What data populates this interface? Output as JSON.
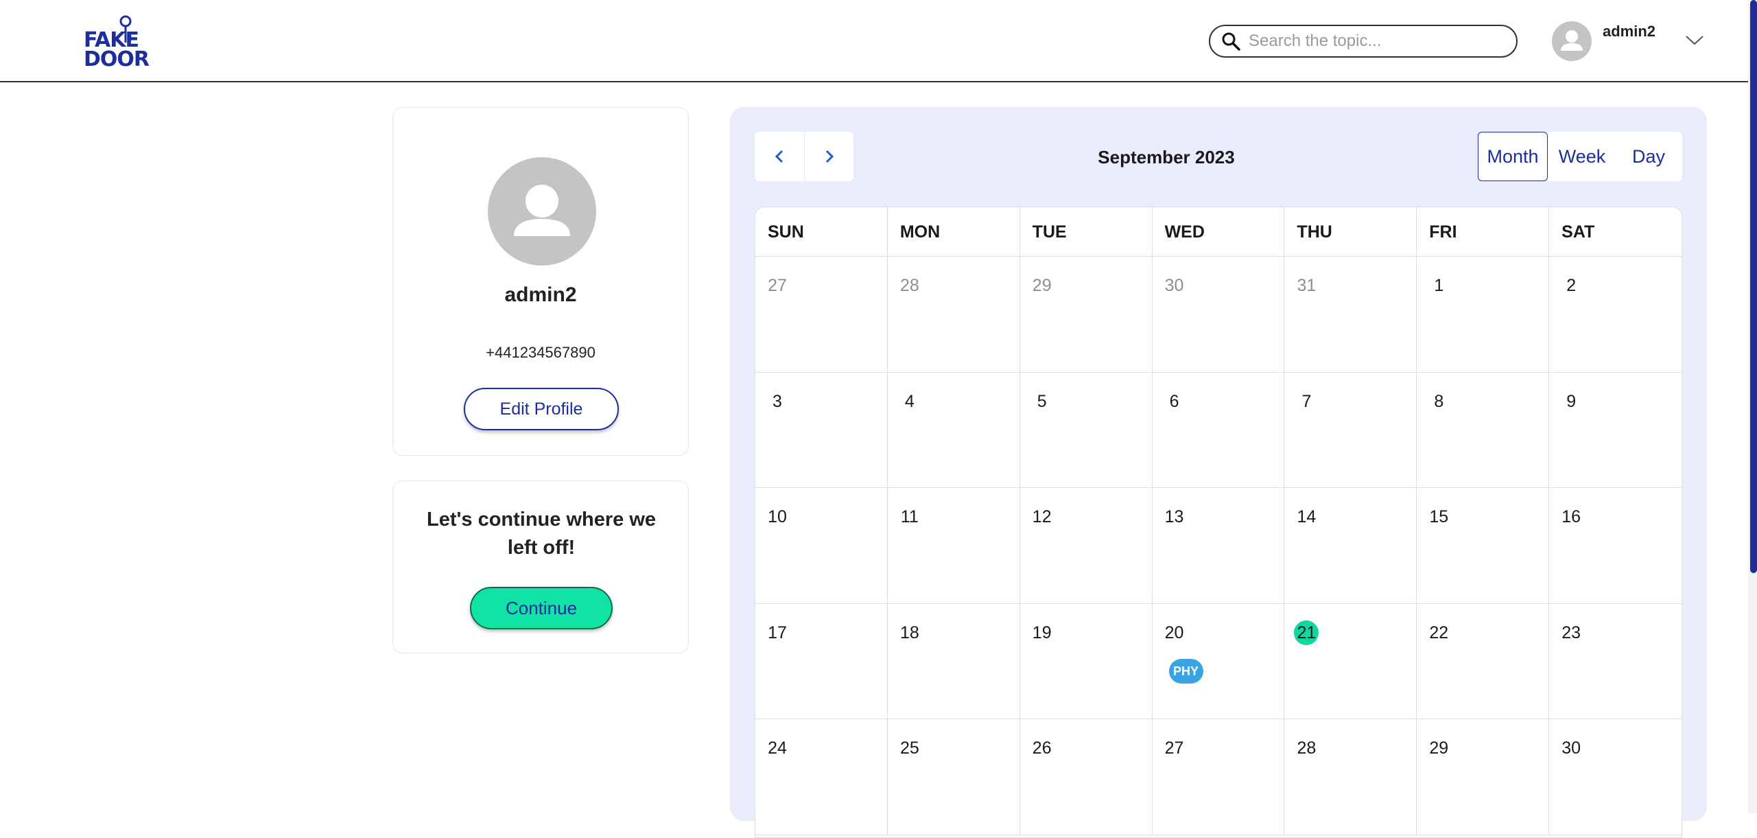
{
  "header": {
    "logo": {
      "line1": "FAKE",
      "line2": "DOOR"
    },
    "search": {
      "placeholder": "Search the topic..."
    },
    "username": "admin2"
  },
  "profile": {
    "name": "admin2",
    "phone": "+441234567890",
    "edit_label": "Edit Profile"
  },
  "continue_card": {
    "message": "Let's continue where we left off!",
    "button_label": "Continue"
  },
  "calendar": {
    "title": "September 2023",
    "views": [
      "Month",
      "Week",
      "Day"
    ],
    "active_view": "Month",
    "weekdays": [
      "SUN",
      "MON",
      "TUE",
      "WED",
      "THU",
      "FRI",
      "SAT"
    ],
    "days": [
      {
        "label": "27",
        "other": true
      },
      {
        "label": "28",
        "other": true
      },
      {
        "label": "29",
        "other": true
      },
      {
        "label": "30",
        "other": true
      },
      {
        "label": "31",
        "other": true
      },
      {
        "label": "1"
      },
      {
        "label": "2"
      },
      {
        "label": "3"
      },
      {
        "label": "4"
      },
      {
        "label": "5"
      },
      {
        "label": "6"
      },
      {
        "label": "7"
      },
      {
        "label": "8"
      },
      {
        "label": "9"
      },
      {
        "label": "10"
      },
      {
        "label": "11"
      },
      {
        "label": "12"
      },
      {
        "label": "13"
      },
      {
        "label": "14"
      },
      {
        "label": "15"
      },
      {
        "label": "16"
      },
      {
        "label": "17"
      },
      {
        "label": "18"
      },
      {
        "label": "19"
      },
      {
        "label": "20",
        "event": "PHY"
      },
      {
        "label": "21",
        "today": true
      },
      {
        "label": "22"
      },
      {
        "label": "23"
      },
      {
        "label": "24"
      },
      {
        "label": "25"
      },
      {
        "label": "26"
      },
      {
        "label": "27"
      },
      {
        "label": "28"
      },
      {
        "label": "29"
      },
      {
        "label": "30"
      }
    ]
  },
  "colors": {
    "brand": "#1c2d9e",
    "accent": "#10e3a4",
    "event": "#3aa3e3",
    "calendar_bg": "#eaecfc"
  }
}
